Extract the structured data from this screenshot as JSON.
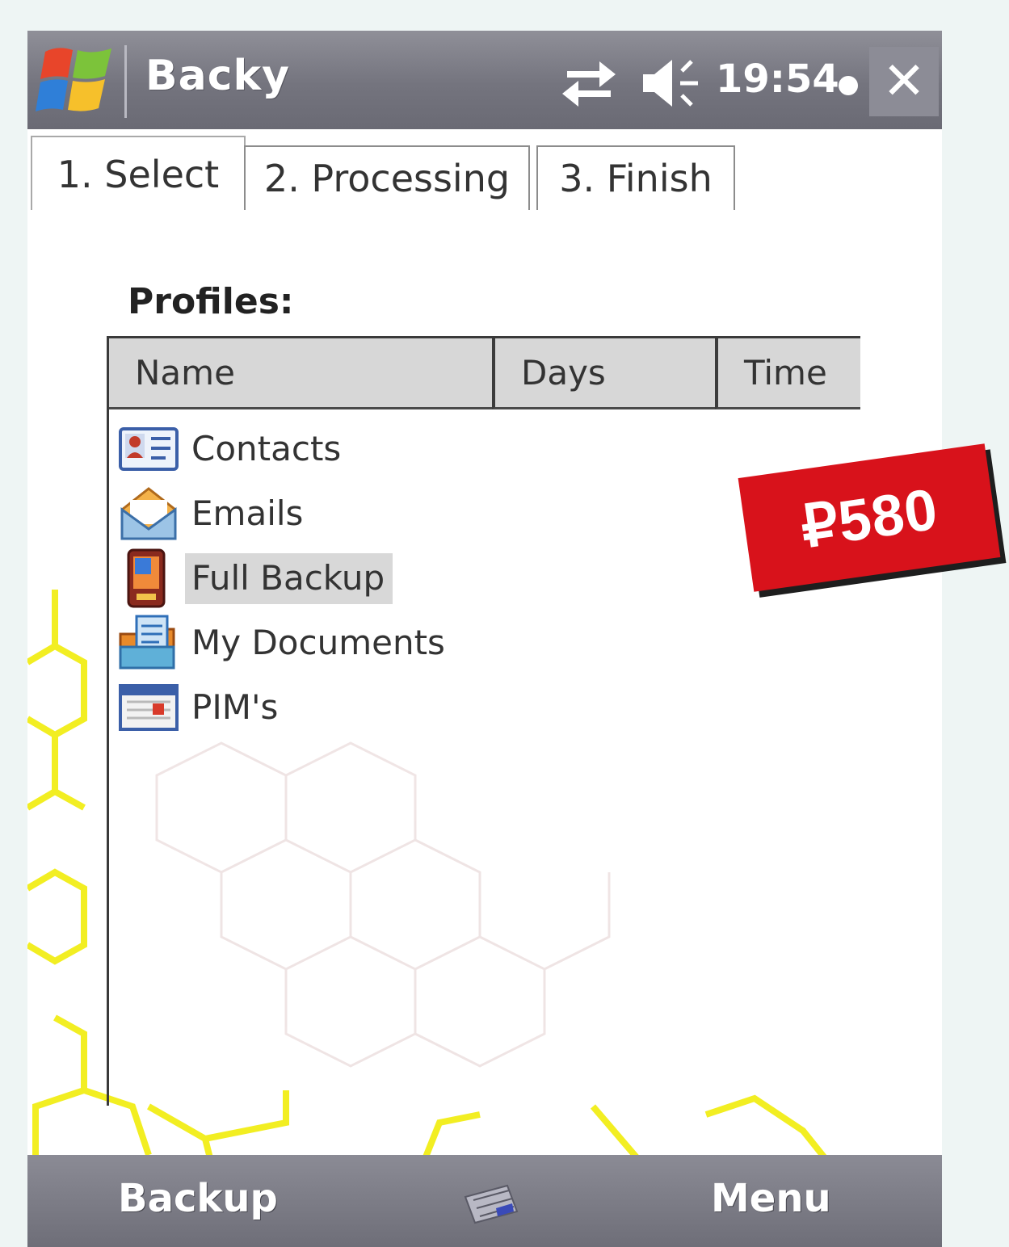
{
  "titlebar": {
    "app_title": "Backy",
    "clock": "19:54",
    "close_label": "✕"
  },
  "tabs": [
    {
      "label": "1. Select",
      "active": true
    },
    {
      "label": "2. Processing",
      "active": false
    },
    {
      "label": "3. Finish",
      "active": false
    }
  ],
  "main": {
    "profiles_label": "Profiles:",
    "columns": [
      "Name",
      "Days",
      "Time"
    ],
    "rows": [
      {
        "label": "Contacts",
        "icon": "contact-card-icon",
        "selected": false
      },
      {
        "label": "Emails",
        "icon": "envelope-icon",
        "selected": false
      },
      {
        "label": "Full Backup",
        "icon": "pda-device-icon",
        "selected": true
      },
      {
        "label": "My Documents",
        "icon": "documents-folder-icon",
        "selected": false
      },
      {
        "label": "PIM's",
        "icon": "calendar-window-icon",
        "selected": false
      }
    ]
  },
  "price_tag": {
    "text": "₽580",
    "color": "#d8121b"
  },
  "softkeys": {
    "left": "Backup",
    "right": "Menu"
  },
  "colors": {
    "titlebar": "#74747e",
    "selection": "#d8d8d8",
    "header": "#d7d7d7"
  }
}
